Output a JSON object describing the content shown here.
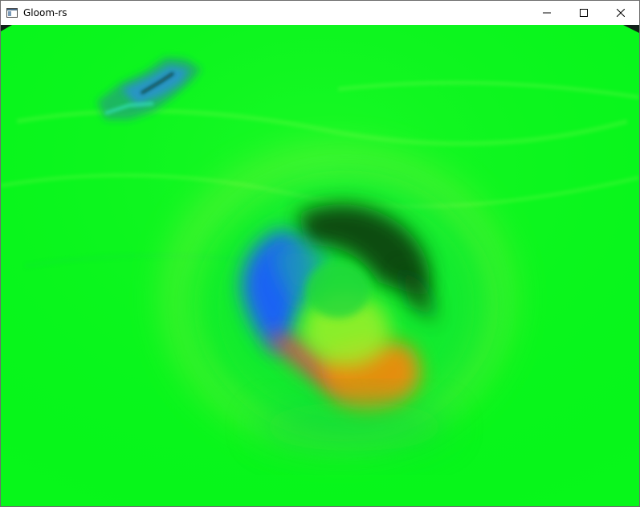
{
  "window": {
    "title": "Gloom-rs"
  },
  "icons": {
    "app": "app-window-icon",
    "minimize": "minimize-icon",
    "maximize": "maximize-icon",
    "close": "close-icon"
  },
  "scene": {
    "base_color": "#07f71a",
    "accent_colors": [
      "#1e5cff",
      "#e43c5a",
      "#f08a10",
      "#0a3a0a",
      "#39e7c6"
    ]
  }
}
